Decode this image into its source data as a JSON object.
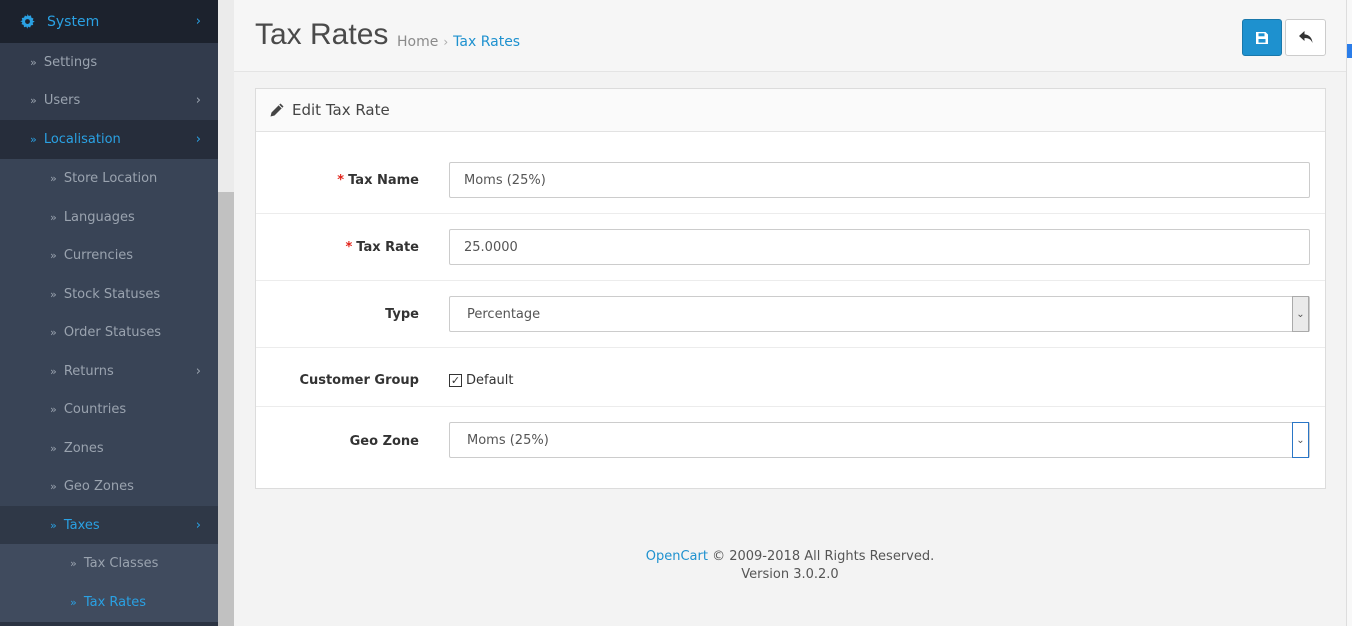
{
  "sidebar": {
    "system": "System",
    "items": [
      {
        "label": "Settings"
      },
      {
        "label": "Users"
      },
      {
        "label": "Localisation"
      },
      {
        "label": "Store Location"
      },
      {
        "label": "Languages"
      },
      {
        "label": "Currencies"
      },
      {
        "label": "Stock Statuses"
      },
      {
        "label": "Order Statuses"
      },
      {
        "label": "Returns"
      },
      {
        "label": "Countries"
      },
      {
        "label": "Zones"
      },
      {
        "label": "Geo Zones"
      },
      {
        "label": "Taxes"
      },
      {
        "label": "Tax Classes"
      },
      {
        "label": "Tax Rates"
      }
    ]
  },
  "header": {
    "title": "Tax Rates",
    "breadcrumb": {
      "home": "Home",
      "separator": "›",
      "current": "Tax Rates"
    }
  },
  "panel": {
    "title": "Edit Tax Rate",
    "fields": {
      "tax_name": {
        "label": "Tax Name",
        "value": "Moms (25%)"
      },
      "tax_rate": {
        "label": "Tax Rate",
        "value": "25.0000"
      },
      "type": {
        "label": "Type",
        "value": "Percentage"
      },
      "customer_group": {
        "label": "Customer Group",
        "option": "Default",
        "checked": true
      },
      "geo_zone": {
        "label": "Geo Zone",
        "value": "Moms (25%)"
      }
    },
    "required_mark": "*"
  },
  "footer": {
    "brand": "OpenCart",
    "copyright": "© 2009-2018 All Rights Reserved.",
    "version": "Version 3.0.2.0"
  },
  "colors": {
    "accent": "#1e91cf",
    "sidebar_bg": "#2b3342",
    "active_link": "#2aa1e3",
    "required": "#e2231a"
  },
  "icons": {
    "system": "gear-icon",
    "save": "save-icon",
    "back": "reply-icon",
    "edit": "pencil-icon",
    "nav_bullet": "double-chevron-right-icon",
    "expand": "chevron-right-icon",
    "select": "chevron-down-icon"
  }
}
